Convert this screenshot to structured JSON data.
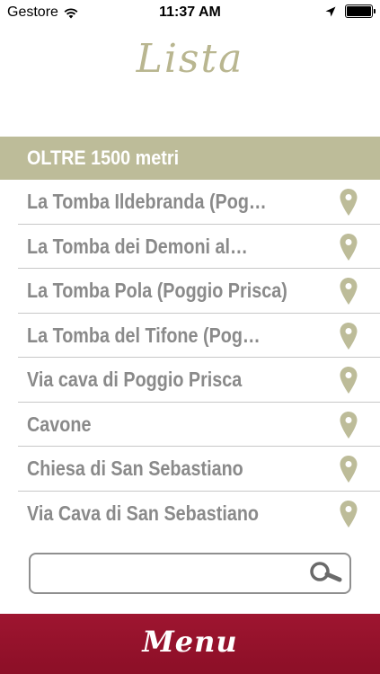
{
  "status_bar": {
    "carrier": "Gestore",
    "time": "11:37 AM",
    "wifi_icon": "wifi-icon",
    "location_icon": "location-arrow-icon",
    "battery_icon": "battery-icon"
  },
  "header": {
    "title": "Lista"
  },
  "section": {
    "title": "OLTRE 1500 metri"
  },
  "list": {
    "items": [
      {
        "label": "La Tomba Ildebranda (Pog…",
        "icon": "map-pin-icon"
      },
      {
        "label": "La Tomba dei Demoni al…",
        "icon": "map-pin-icon"
      },
      {
        "label": "La Tomba Pola (Poggio Prisca)",
        "icon": "map-pin-icon"
      },
      {
        "label": "La Tomba del Tifone (Pog…",
        "icon": "map-pin-icon"
      },
      {
        "label": "Via cava di Poggio Prisca",
        "icon": "map-pin-icon"
      },
      {
        "label": "Cavone",
        "icon": "map-pin-icon"
      },
      {
        "label": "Chiesa di San Sebastiano",
        "icon": "map-pin-icon"
      },
      {
        "label": "Via Cava di San Sebastiano",
        "icon": "map-pin-icon"
      }
    ]
  },
  "search": {
    "value": "",
    "placeholder": "",
    "icon": "search-icon"
  },
  "footer": {
    "menu_label": "Menu"
  },
  "colors": {
    "accent": "#bdbc99",
    "title": "#b9b690",
    "menu_bar": "#9e1530",
    "item_text": "#8a8a8a",
    "pin": "#bdbc99"
  }
}
